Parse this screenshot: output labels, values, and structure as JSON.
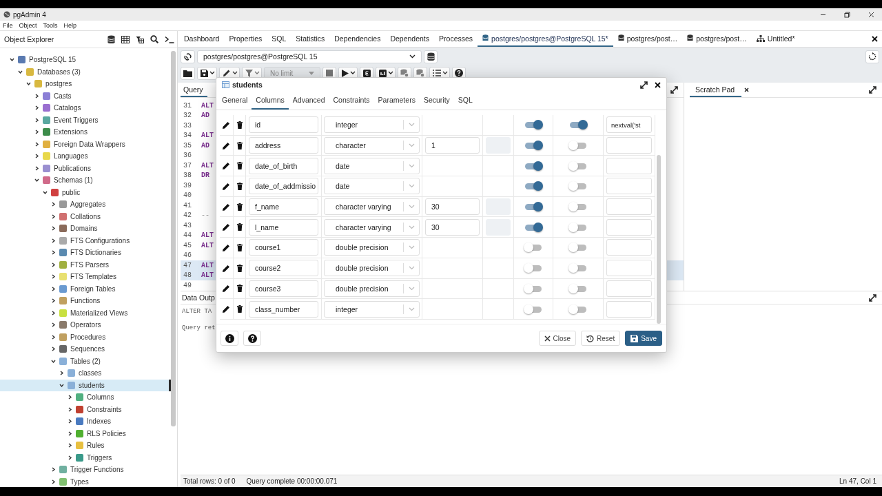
{
  "window": {
    "title": "pgAdmin 4"
  },
  "menu": [
    "File",
    "Object",
    "Tools",
    "Help"
  ],
  "explorer": {
    "title": "Object Explorer",
    "tree": [
      {
        "label": "PostgreSQL 15",
        "expanded": true,
        "selected": false,
        "color": "#5a7ab0",
        "children": [
          {
            "label": "Databases (3)",
            "expanded": true,
            "selected": false,
            "color": "#d8b840",
            "children": [
              {
                "label": "postgres",
                "expanded": true,
                "selected": false,
                "color": "#d8b840",
                "children": [
                  {
                    "label": "Casts",
                    "expanded": false,
                    "selected": false,
                    "color": "#8b7fd6"
                  },
                  {
                    "label": "Catalogs",
                    "expanded": false,
                    "selected": false,
                    "color": "#9a6fd0"
                  },
                  {
                    "label": "Event Triggers",
                    "expanded": false,
                    "selected": false,
                    "color": "#5aa8a0"
                  },
                  {
                    "label": "Extensions",
                    "expanded": false,
                    "selected": false,
                    "color": "#3c8c4a"
                  },
                  {
                    "label": "Foreign Data Wrappers",
                    "expanded": false,
                    "selected": false,
                    "color": "#e0b040"
                  },
                  {
                    "label": "Languages",
                    "expanded": false,
                    "selected": false,
                    "color": "#e8d84a"
                  },
                  {
                    "label": "Publications",
                    "expanded": false,
                    "selected": false,
                    "color": "#9a8fd0"
                  },
                  {
                    "label": "Schemas (1)",
                    "expanded": true,
                    "selected": false,
                    "color": "#d06a8a",
                    "children": [
                      {
                        "label": "public",
                        "expanded": true,
                        "selected": false,
                        "color": "#d04040",
                        "children": [
                          {
                            "label": "Aggregates",
                            "expanded": false,
                            "selected": false,
                            "color": "#999999"
                          },
                          {
                            "label": "Collations",
                            "expanded": false,
                            "selected": false,
                            "color": "#d07070"
                          },
                          {
                            "label": "Domains",
                            "expanded": false,
                            "selected": false,
                            "color": "#8a6a5a"
                          },
                          {
                            "label": "FTS Configurations",
                            "expanded": false,
                            "selected": false,
                            "color": "#aaaaaa"
                          },
                          {
                            "label": "FTS Dictionaries",
                            "expanded": false,
                            "selected": false,
                            "color": "#5a8ab0"
                          },
                          {
                            "label": "FTS Parsers",
                            "expanded": false,
                            "selected": false,
                            "color": "#a0b040"
                          },
                          {
                            "label": "FTS Templates",
                            "expanded": false,
                            "selected": false,
                            "color": "#e8e070"
                          },
                          {
                            "label": "Foreign Tables",
                            "expanded": false,
                            "selected": false,
                            "color": "#6a9ad0"
                          },
                          {
                            "label": "Functions",
                            "expanded": false,
                            "selected": false,
                            "color": "#c0a060"
                          },
                          {
                            "label": "Materialized Views",
                            "expanded": false,
                            "selected": false,
                            "color": "#c8e040"
                          },
                          {
                            "label": "Operators",
                            "expanded": false,
                            "selected": false,
                            "color": "#8a7a6a"
                          },
                          {
                            "label": "Procedures",
                            "expanded": false,
                            "selected": false,
                            "color": "#c0a060"
                          },
                          {
                            "label": "Sequences",
                            "expanded": false,
                            "selected": false,
                            "color": "#666666"
                          },
                          {
                            "label": "Tables (2)",
                            "expanded": true,
                            "selected": false,
                            "color": "#8ab0d8",
                            "children": [
                              {
                                "label": "classes",
                                "expanded": false,
                                "selected": false,
                                "color": "#8ab0d8"
                              },
                              {
                                "label": "students",
                                "expanded": true,
                                "selected": true,
                                "color": "#8ab0d8",
                                "children": [
                                  {
                                    "label": "Columns",
                                    "expanded": false,
                                    "selected": false,
                                    "color": "#50b080"
                                  },
                                  {
                                    "label": "Constraints",
                                    "expanded": false,
                                    "selected": false,
                                    "color": "#c04030"
                                  },
                                  {
                                    "label": "Indexes",
                                    "expanded": false,
                                    "selected": false,
                                    "color": "#4a7ac0"
                                  },
                                  {
                                    "label": "RLS Policies",
                                    "expanded": false,
                                    "selected": false,
                                    "color": "#50b030"
                                  },
                                  {
                                    "label": "Rules",
                                    "expanded": false,
                                    "selected": false,
                                    "color": "#e8c040"
                                  },
                                  {
                                    "label": "Triggers",
                                    "expanded": false,
                                    "selected": false,
                                    "color": "#3a9a8a"
                                  }
                                ]
                              }
                            ]
                          },
                          {
                            "label": "Trigger Functions",
                            "expanded": false,
                            "selected": false,
                            "color": "#70b0a0"
                          },
                          {
                            "label": "Types",
                            "expanded": false,
                            "selected": false,
                            "color": "#80c070"
                          }
                        ]
                      }
                    ]
                  }
                ]
              }
            ]
          }
        ]
      }
    ]
  },
  "tabs": [
    {
      "label": "Dashboard",
      "kind": "panel",
      "selected": false
    },
    {
      "label": "Properties",
      "kind": "panel",
      "selected": false
    },
    {
      "label": "SQL",
      "kind": "panel",
      "selected": false
    },
    {
      "label": "Statistics",
      "kind": "panel",
      "selected": false
    },
    {
      "label": "Dependencies",
      "kind": "panel",
      "selected": false
    },
    {
      "label": "Dependents",
      "kind": "panel",
      "selected": false
    },
    {
      "label": "Processes",
      "kind": "panel",
      "selected": false
    },
    {
      "label": "postgres/postgres@PostgreSQL 15*",
      "kind": "query",
      "selected": true
    },
    {
      "label": "postgres/post…",
      "kind": "query",
      "selected": false
    },
    {
      "label": "postgres/post…",
      "kind": "query",
      "selected": false
    },
    {
      "label": "Untitled*",
      "kind": "erd",
      "selected": false
    }
  ],
  "connection": {
    "value": "postgres/postgres@PostgreSQL 15"
  },
  "toolbar": {
    "limit": "No limit"
  },
  "query_tool": {
    "tab": "Query",
    "lines": [
      {
        "number": "31",
        "code": "ALT",
        "kind": "keyword",
        "selected": false
      },
      {
        "number": "32",
        "code": "AD",
        "kind": "keyword",
        "selected": false
      },
      {
        "number": "33",
        "selected": false
      },
      {
        "number": "34",
        "code": "ALT",
        "kind": "keyword",
        "selected": false
      },
      {
        "number": "35",
        "code": "AD",
        "kind": "keyword",
        "selected": false
      },
      {
        "number": "36",
        "selected": false
      },
      {
        "number": "37",
        "code": "ALT",
        "kind": "keyword",
        "selected": false
      },
      {
        "number": "38",
        "code": "DR",
        "kind": "keyword",
        "selected": false
      },
      {
        "number": "39",
        "selected": false
      },
      {
        "number": "40",
        "selected": false
      },
      {
        "number": "41",
        "selected": false
      },
      {
        "number": "42",
        "code": "--",
        "kind": "comment",
        "selected": false
      },
      {
        "number": "43",
        "selected": false
      },
      {
        "number": "44",
        "code": "ALT",
        "kind": "keyword",
        "selected": false
      },
      {
        "number": "45",
        "code": "ALT",
        "kind": "keyword",
        "selected": false
      },
      {
        "number": "46",
        "selected": false
      },
      {
        "number": "47",
        "code": "ALT",
        "kind": "keyword",
        "selected": true
      },
      {
        "number": "48",
        "code": "ALT",
        "kind": "keyword",
        "selected": true
      },
      {
        "number": "49",
        "selected": false
      }
    ],
    "output_tab": "Data Outp",
    "output_lines": [
      "ALTER TA",
      "Query ret"
    ]
  },
  "scratch_pad": {
    "title": "Scratch Pad"
  },
  "dialog": {
    "title": "students",
    "tabs": [
      {
        "label": "General",
        "selected": false
      },
      {
        "label": "Columns",
        "selected": true
      },
      {
        "label": "Advanced",
        "selected": false
      },
      {
        "label": "Constraints",
        "selected": false
      },
      {
        "label": "Parameters",
        "selected": false
      },
      {
        "label": "Security",
        "selected": false
      },
      {
        "label": "SQL",
        "selected": false
      }
    ],
    "rows": [
      {
        "name": "id",
        "type": "integer",
        "not_null": true,
        "primary_key": true,
        "default": "nextval('st"
      },
      {
        "name": "address",
        "type": "character",
        "length": "1",
        "not_null": true,
        "primary_key": false
      },
      {
        "name": "date_of_birth",
        "type": "date",
        "not_null": true,
        "primary_key": false
      },
      {
        "name": "date_of_addmissio",
        "type": "date",
        "not_null": true,
        "primary_key": false
      },
      {
        "name": "f_name",
        "type": "character varying",
        "length": "30",
        "not_null": true,
        "primary_key": false
      },
      {
        "name": "l_name",
        "type": "character varying",
        "length": "30",
        "not_null": true,
        "primary_key": false
      },
      {
        "name": "course1",
        "type": "double precision",
        "not_null": false,
        "primary_key": false
      },
      {
        "name": "course2",
        "type": "double precision",
        "not_null": false,
        "primary_key": false
      },
      {
        "name": "course3",
        "type": "double precision",
        "not_null": false,
        "primary_key": false
      },
      {
        "name": "class_number",
        "type": "integer",
        "not_null": false,
        "primary_key": false
      }
    ],
    "buttons": [
      {
        "label": "Close",
        "kind": "close"
      },
      {
        "label": "Reset",
        "kind": "reset"
      },
      {
        "label": "Save",
        "kind": "save"
      }
    ]
  },
  "status": {
    "rows": "Total rows: 0 of 0",
    "query": "Query complete 00:00:00.071",
    "cursor": "Ln 47, Col 1"
  }
}
